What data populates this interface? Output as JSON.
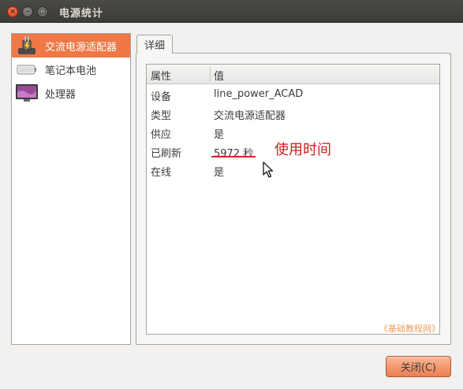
{
  "window": {
    "title": "电源统计",
    "buttons": {
      "close": "×",
      "minimize": "–",
      "maximize": "▢"
    }
  },
  "sidebar": {
    "items": [
      {
        "label": "交流电源适配器",
        "icon": "power-plug-icon",
        "selected": true
      },
      {
        "label": "笔记本电池",
        "icon": "battery-icon",
        "selected": false
      },
      {
        "label": "处理器",
        "icon": "processor-icon",
        "selected": false
      }
    ]
  },
  "tabs": [
    {
      "label": "详细",
      "active": true
    }
  ],
  "details": {
    "headers": {
      "property": "属性",
      "value": "值"
    },
    "rows": [
      {
        "property": "设备",
        "value": "line_power_ACAD"
      },
      {
        "property": "类型",
        "value": "交流电源适配器"
      },
      {
        "property": "供应",
        "value": "是"
      },
      {
        "property": "已刷新",
        "value": "5972 秒"
      },
      {
        "property": "在线",
        "value": "是"
      }
    ]
  },
  "annotation": {
    "text": "使用时间",
    "color": "#d01d1d"
  },
  "watermark": "《基础教程网》",
  "footer": {
    "close_label": "关闭(C)"
  },
  "colors": {
    "accent": "#f07746",
    "titlebar": "#3c3b37",
    "annotation": "#d01d1d"
  }
}
